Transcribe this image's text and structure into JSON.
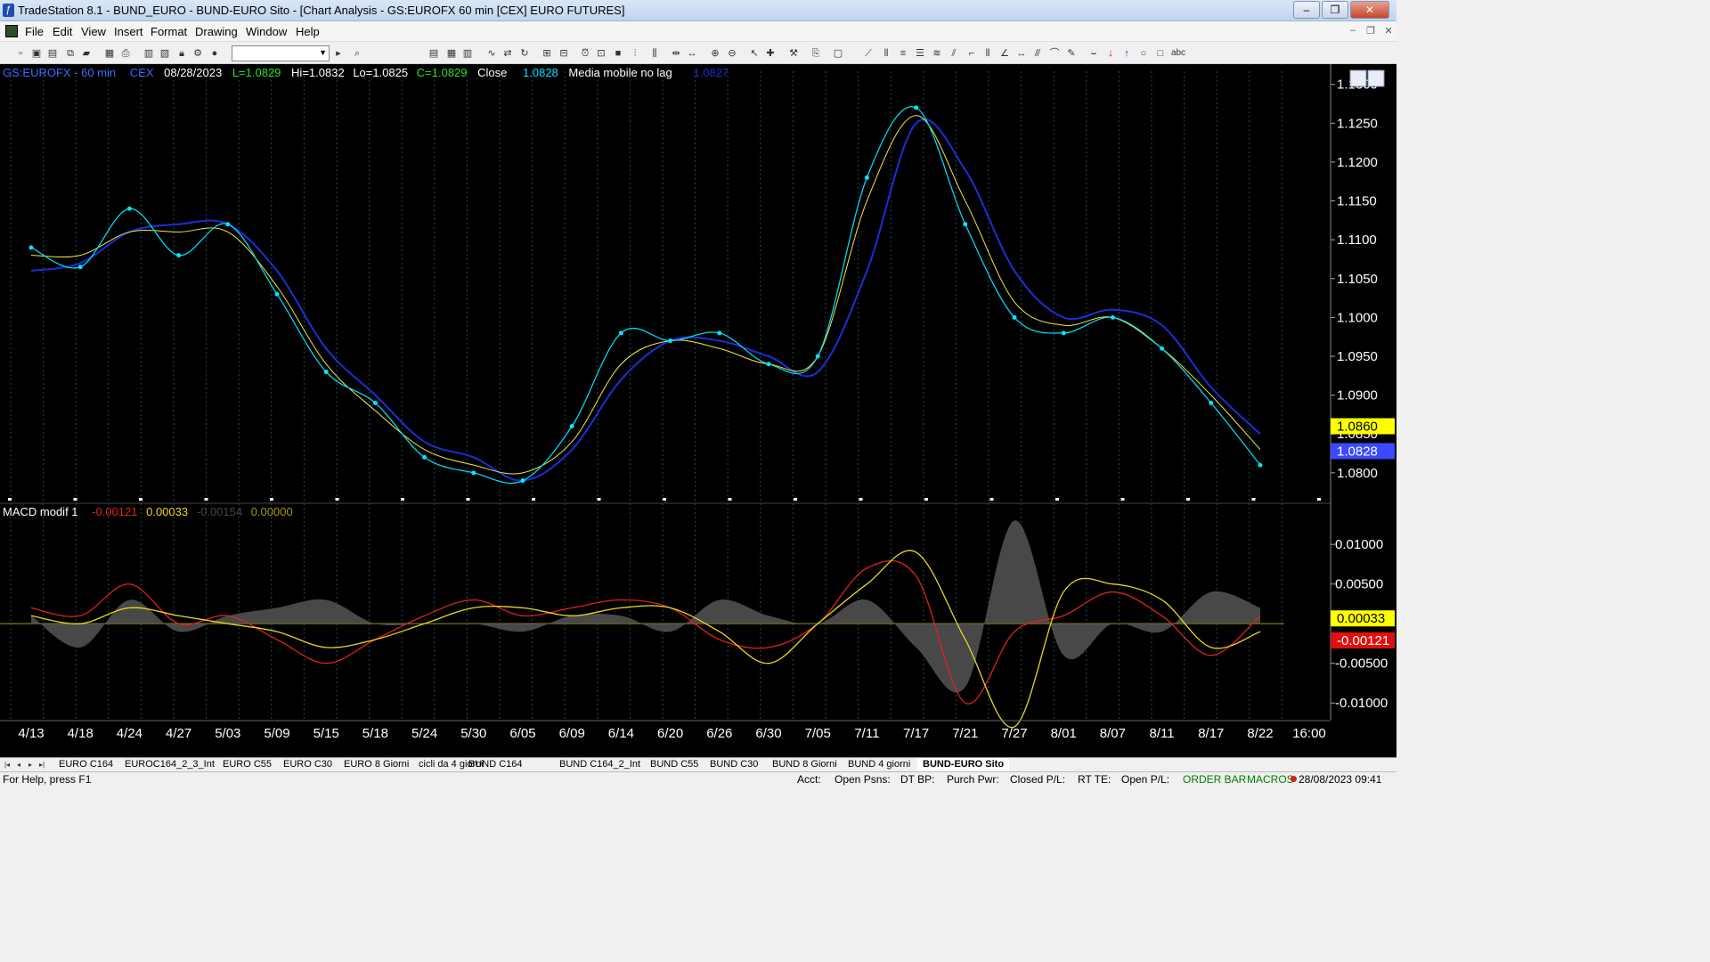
{
  "window": {
    "title": "TradeStation 8.1 - BUND_EURO - BUND-EURO Sito - [Chart Analysis - GS:EUROFX  60 min  [CEX] EURO FUTURES]",
    "minimize": "‒",
    "maximize": "❐",
    "close": "✕"
  },
  "menu": [
    "File",
    "Edit",
    "View",
    "Insert",
    "Format",
    "Drawing",
    "Window",
    "Help"
  ],
  "mdi_controls": [
    "–",
    "❐",
    "✕"
  ],
  "price_header": {
    "symbol": "GS:EUROFX - 60 min",
    "exchange": "CEX",
    "date": "08/28/2023",
    "last": "L=1.0829",
    "high": "Hi=1.0832",
    "low": "Lo=1.0825",
    "close": "C=1.0829",
    "close_label": "Close",
    "close_value": "1.0828",
    "indicator_name": "Media mobile no lag",
    "indicator_value": "1.0827"
  },
  "macd_header": {
    "name": "MACD modif 1",
    "v1": "-0.00121",
    "v2": "0.00033",
    "v3": "-0.00154",
    "v4": "0.00000"
  },
  "price_axis": {
    "ticks": [
      "1.1300",
      "1.1250",
      "1.1200",
      "1.1150",
      "1.1100",
      "1.1050",
      "1.1000",
      "1.0950",
      "1.0900",
      "1.0850",
      "1.0800"
    ],
    "badge_yellow": "1.0860",
    "badge_blue": "1.0828"
  },
  "macd_axis": {
    "ticks": [
      "0.01000",
      "0.00500",
      "-0.00500",
      "-0.01000"
    ],
    "badge_yellow": "0.00033",
    "badge_red": "-0.00121"
  },
  "x_axis": [
    "4/13",
    "4/18",
    "4/24",
    "4/27",
    "5/03",
    "5/09",
    "5/15",
    "5/18",
    "5/24",
    "5/30",
    "6/05",
    "6/09",
    "6/14",
    "6/20",
    "6/26",
    "6/30",
    "7/05",
    "7/11",
    "7/17",
    "7/21",
    "7/27",
    "8/01",
    "8/07",
    "8/11",
    "8/17",
    "8/22",
    "16:00"
  ],
  "chart_data": [
    {
      "type": "line",
      "title": "GS:EUROFX - 60 min",
      "ylim": [
        1.077,
        1.131
      ],
      "x": [
        "4/13",
        "4/18",
        "4/24",
        "4/27",
        "5/03",
        "5/09",
        "5/15",
        "5/18",
        "5/24",
        "5/30",
        "6/05",
        "6/09",
        "6/14",
        "6/20",
        "6/26",
        "6/30",
        "7/05",
        "7/11",
        "7/17",
        "7/21",
        "7/27",
        "8/01",
        "8/07",
        "8/11",
        "8/17",
        "8/22"
      ],
      "series": [
        {
          "name": "Close",
          "color": "#00e5ff",
          "values": [
            1.109,
            1.1065,
            1.114,
            1.108,
            1.112,
            1.103,
            1.093,
            1.089,
            1.082,
            1.08,
            1.079,
            1.086,
            1.098,
            1.097,
            1.098,
            1.094,
            1.095,
            1.118,
            1.127,
            1.112,
            1.1,
            1.098,
            1.1,
            1.096,
            1.089,
            1.081
          ]
        },
        {
          "name": "Media mobile no lag",
          "color": "#f5e642",
          "values": [
            1.108,
            1.108,
            1.111,
            1.111,
            1.111,
            1.104,
            1.094,
            1.088,
            1.083,
            1.081,
            1.08,
            1.084,
            1.094,
            1.097,
            1.096,
            1.094,
            1.095,
            1.115,
            1.126,
            1.115,
            1.102,
            1.099,
            1.1,
            1.096,
            1.09,
            1.083
          ]
        },
        {
          "color": "#1a2fd6",
          "values": [
            1.106,
            1.107,
            1.111,
            1.112,
            1.112,
            1.106,
            1.096,
            1.09,
            1.084,
            1.082,
            1.079,
            1.083,
            1.092,
            1.097,
            1.097,
            1.095,
            1.093,
            1.106,
            1.125,
            1.119,
            1.106,
            1.1,
            1.101,
            1.099,
            1.091,
            1.085
          ]
        }
      ]
    },
    {
      "type": "line",
      "title": "MACD modif 1",
      "ylim": [
        -0.012,
        0.0135
      ],
      "x": [
        "4/13",
        "4/18",
        "4/24",
        "4/27",
        "5/03",
        "5/09",
        "5/15",
        "5/18",
        "5/24",
        "5/30",
        "6/05",
        "6/09",
        "6/14",
        "6/20",
        "6/26",
        "6/30",
        "7/05",
        "7/11",
        "7/17",
        "7/21",
        "7/27",
        "8/01",
        "8/07",
        "8/11",
        "8/17",
        "8/22"
      ],
      "series": [
        {
          "color": "#e02020",
          "values": [
            0.002,
            0.001,
            0.005,
            0.0,
            0.001,
            -0.002,
            -0.005,
            -0.002,
            0.001,
            0.003,
            0.001,
            0.002,
            0.003,
            0.002,
            -0.002,
            -0.003,
            0.0,
            0.007,
            0.006,
            -0.01,
            -0.001,
            0.001,
            0.004,
            0.001,
            -0.004,
            0.001
          ]
        },
        {
          "color": "#e8d820",
          "values": [
            0.001,
            0.0,
            0.002,
            0.001,
            0.0,
            -0.001,
            -0.003,
            -0.002,
            0.0,
            0.002,
            0.002,
            0.001,
            0.002,
            0.002,
            -0.001,
            -0.005,
            0.0,
            0.005,
            0.009,
            -0.002,
            -0.013,
            0.004,
            0.005,
            0.003,
            -0.003,
            -0.001
          ]
        },
        {
          "color": "#555555",
          "values": [
            0.001,
            -0.003,
            0.003,
            -0.001,
            0.001,
            0.002,
            0.003,
            0.0,
            0.0,
            0.0,
            -0.001,
            0.001,
            0.001,
            -0.001,
            0.003,
            0.001,
            0.0,
            0.003,
            -0.003,
            -0.008,
            0.013,
            -0.004,
            0.0,
            -0.001,
            0.004,
            0.002
          ]
        }
      ]
    }
  ],
  "tabs": [
    "EURO C164",
    "EUROC164_2_3_Int",
    "EURO C55",
    "EURO C30",
    "EURO 8 Giorni",
    "cicli da 4 giorni",
    "BUND C164",
    "BUND C164_2_Int",
    "BUND C55",
    "BUND  C30",
    "BUND 8 Giorni",
    "BUND 4 giorni",
    "BUND-EURO Sito"
  ],
  "tab_nav": [
    "|◂",
    "◂",
    "▸",
    "▸|"
  ],
  "status": {
    "help": "For Help, press F1",
    "acct": "Acct:",
    "open_psns": "Open Psns:",
    "dtbp": "DT BP:",
    "purch_pwr": "Purch Pwr:",
    "closed_pl": "Closed P/L:",
    "rt_te": "RT TE:",
    "open_pl": "Open P/L:",
    "order_bar": "ORDER BAR",
    "macros": "MACROS",
    "datetime": "28/08/2023 09:41"
  },
  "colors": {
    "close_line": "#00e5ff",
    "nolag_ma": "#f5e642",
    "blue_ma": "#1a2fd6",
    "macd_red": "#e02020",
    "macd_yellow": "#e8d820",
    "macd_histogram": "#555555"
  }
}
